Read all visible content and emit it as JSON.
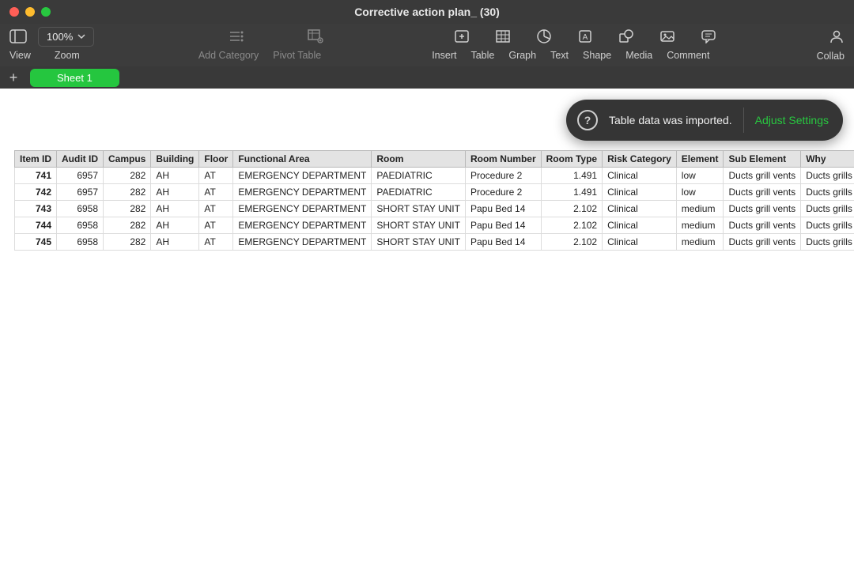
{
  "window": {
    "title": "Corrective action plan_ (30)"
  },
  "toolbar": {
    "zoom_value": "100%",
    "view": "View",
    "zoom": "Zoom",
    "add_category": "Add Category",
    "pivot_table": "Pivot Table",
    "insert": "Insert",
    "table": "Table",
    "graph": "Graph",
    "text": "Text",
    "shape": "Shape",
    "media": "Media",
    "comment": "Comment",
    "collaborate": "Collab"
  },
  "sheets": {
    "active": "Sheet 1"
  },
  "toast": {
    "message": "Table data was imported.",
    "action": "Adjust Settings"
  },
  "table": {
    "headers": [
      "Item ID",
      "Audit ID",
      "Campus",
      "Building",
      "Floor",
      "Functional Area",
      "Room",
      "Room Number",
      "Room Type",
      "Risk Category",
      "Element",
      "Sub Element",
      "Why"
    ],
    "rows": [
      {
        "item_id": "741",
        "audit_id": "6957",
        "campus": "282",
        "building": "AH",
        "floor": "AT",
        "functional_area": "EMERGENCY DEPARTMENT",
        "room": "PAEDIATRIC",
        "room_number": "Procedure 2",
        "room_type": "1.491",
        "risk_category": "Clinical",
        "element": "low",
        "sub_element": "Ducts grill vents",
        "why": "Ducts grills and vents are in place and"
      },
      {
        "item_id": "742",
        "audit_id": "6957",
        "campus": "282",
        "building": "AH",
        "floor": "AT",
        "functional_area": "EMERGENCY DEPARTMENT",
        "room": "PAEDIATRIC",
        "room_number": "Procedure 2",
        "room_type": "1.491",
        "risk_category": "Clinical",
        "element": "low",
        "sub_element": "Ducts grill vents",
        "why": "Ducts grills and vents are intact and n"
      },
      {
        "item_id": "743",
        "audit_id": "6958",
        "campus": "282",
        "building": "AH",
        "floor": "AT",
        "functional_area": "EMERGENCY DEPARTMENT",
        "room": "SHORT STAY UNIT",
        "room_number": "Papu Bed 14",
        "room_type": "2.102",
        "risk_category": "Clinical",
        "element": "medium",
        "sub_element": "Ducts grill vents",
        "why": "Ducts grills and vents are in place and"
      },
      {
        "item_id": "744",
        "audit_id": "6958",
        "campus": "282",
        "building": "AH",
        "floor": "AT",
        "functional_area": "EMERGENCY DEPARTMENT",
        "room": "SHORT STAY UNIT",
        "room_number": "Papu Bed 14",
        "room_type": "2.102",
        "risk_category": "Clinical",
        "element": "medium",
        "sub_element": "Ducts grill vents",
        "why": "Ducts grills and vents are free from du"
      },
      {
        "item_id": "745",
        "audit_id": "6958",
        "campus": "282",
        "building": "AH",
        "floor": "AT",
        "functional_area": "EMERGENCY DEPARTMENT",
        "room": "SHORT STAY UNIT",
        "room_number": "Papu Bed 14",
        "room_type": "2.102",
        "risk_category": "Clinical",
        "element": "medium",
        "sub_element": "Ducts grill vents",
        "why": "Ducts grills and vents are intact and n"
      }
    ]
  }
}
